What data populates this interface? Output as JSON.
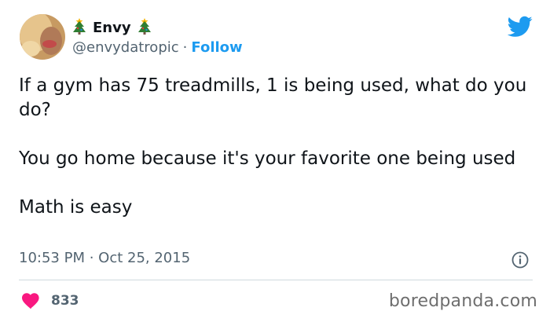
{
  "author": {
    "display_name": "Envy",
    "handle": "@envydatropic",
    "separator": "·",
    "follow_label": "Follow",
    "name_icons": [
      "christmas-tree-icon",
      "christmas-tree-icon"
    ]
  },
  "tweet": {
    "paragraphs": [
      "If a gym has 75 treadmills,  1 is being used, what do you do?",
      "You go home because it's your favorite one being used",
      "Math is easy"
    ],
    "timestamp": "10:53 PM · Oct 25, 2015"
  },
  "engagement": {
    "like_count": "833"
  },
  "watermark": "boredpanda.com",
  "colors": {
    "twitter_blue": "#1d9bf0",
    "heart_red": "#f91880",
    "text_primary": "#0f1419",
    "text_secondary": "#536471"
  }
}
